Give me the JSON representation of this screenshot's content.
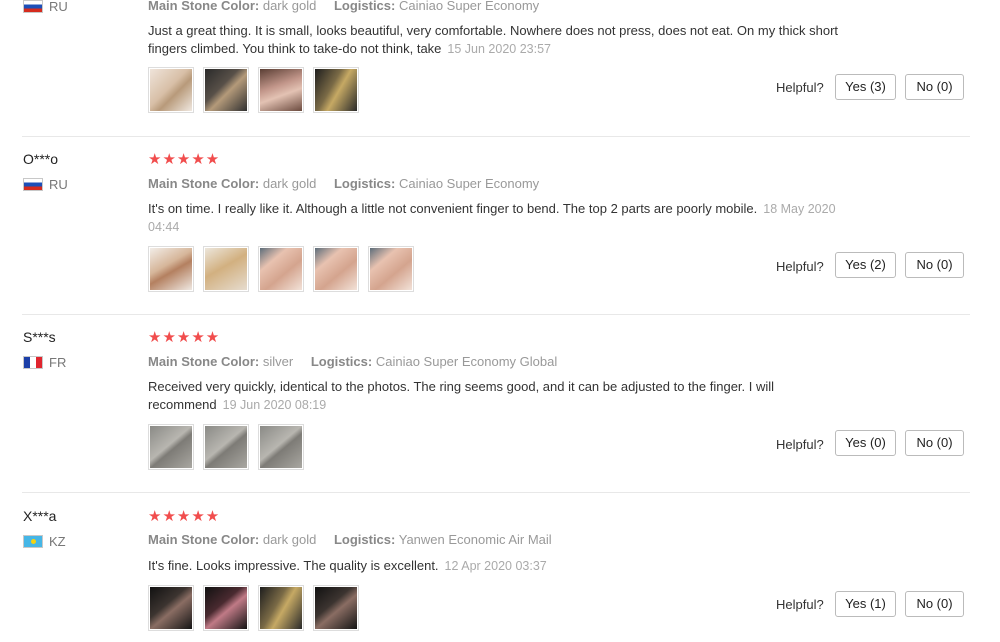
{
  "labels": {
    "main_stone_color": "Main Stone Color:",
    "logistics": "Logistics:",
    "helpful": "Helpful?"
  },
  "colors": {
    "star": "#f14d4d",
    "divider": "#e8e8e8"
  },
  "reviews": [
    {
      "user": "",
      "country": "RU",
      "flag": "flag-ru",
      "stars": "",
      "stone_color": "dark gold",
      "logistics": "Cainiao Super Economy",
      "text": "Just a great thing. It is small, looks beautiful, very comfortable. Nowhere does not press, does not eat. On my thick short fingers climbed. You think to take-do not think, take",
      "date": "15 Jun 2020 23:57",
      "photo_count": 4,
      "yes": "Yes (3)",
      "no": "No (0)"
    },
    {
      "user": "O***o",
      "country": "RU",
      "flag": "flag-ru",
      "stars": "★★★★★",
      "stone_color": "dark gold",
      "logistics": "Cainiao Super Economy",
      "text": "It's on time. I really like it. Although a little not convenient finger to bend. The top 2 parts are poorly mobile.",
      "date": "18 May 2020 04:44",
      "photo_count": 5,
      "yes": "Yes (2)",
      "no": "No (0)"
    },
    {
      "user": "S***s",
      "country": "FR",
      "flag": "flag-fr",
      "stars": "★★★★★",
      "stone_color": "silver",
      "logistics": "Cainiao Super Economy Global",
      "text": "Received very quickly, identical to the photos. The ring seems good, and it can be adjusted to the finger. I will recommend",
      "date": "19 Jun 2020 08:19",
      "photo_count": 3,
      "yes": "Yes (0)",
      "no": "No (0)"
    },
    {
      "user": "X***a",
      "country": "KZ",
      "flag": "flag-kz",
      "stars": "★★★★★",
      "stone_color": "dark gold",
      "logistics": "Yanwen Economic Air Mail",
      "text": "It's fine. Looks impressive. The quality is excellent.",
      "date": "12 Apr 2020 03:37",
      "photo_count": 4,
      "yes": "Yes (1)",
      "no": "No (0)"
    }
  ]
}
